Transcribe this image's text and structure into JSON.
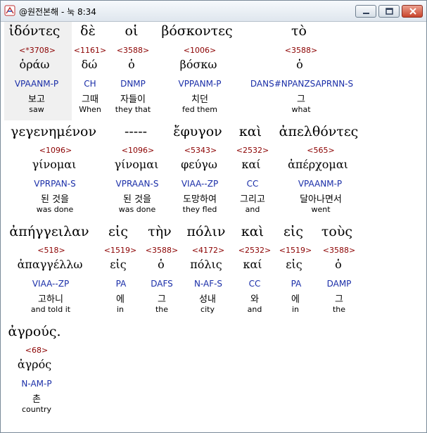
{
  "window": {
    "title": "@원전본해 - 눅 8:34"
  },
  "rows": [
    {
      "words": [
        {
          "greek": "ἰδόντες",
          "strong": "<*3708>",
          "lemma": "ὁράω",
          "parse": "VPAANM-P",
          "korean": "보고",
          "english": "saw"
        },
        {
          "greek": "δὲ",
          "strong": "<1161>",
          "lemma": "δώ",
          "parse": "CH",
          "korean": "그때",
          "english": "When"
        },
        {
          "greek": "οἱ",
          "strong": "<3588>",
          "lemma": "ὁ",
          "parse": "DNMP",
          "korean": "자들이",
          "english": "they that"
        },
        {
          "greek": "βόσκοντες",
          "strong": "<1006>",
          "lemma": "βόσκω",
          "parse": "VPPANM-P",
          "korean": "치던",
          "english": "fed them"
        },
        {
          "greek": "τὸ",
          "strong": "<3588>",
          "lemma": "ὁ",
          "parse": "DANS#NPANZSAPRNN-S",
          "korean": "그",
          "english": "what"
        }
      ]
    },
    {
      "words": [
        {
          "greek": "γεγενημένον",
          "strong": "<1096>",
          "lemma": "γίνομαι",
          "parse": "VPRPAN-S",
          "korean": "된 것을",
          "english": "was done"
        },
        {
          "greek": "-----",
          "strong": "<1096>",
          "lemma": "γίνομαι",
          "parse": "VPRAAN-S",
          "korean": "된 것을",
          "english": "was done"
        },
        {
          "greek": "ἔφυγον",
          "strong": "<5343>",
          "lemma": "φεύγω",
          "parse": "VIAA--ZP",
          "korean": "도망하여",
          "english": "they fled"
        },
        {
          "greek": "καὶ",
          "strong": "<2532>",
          "lemma": "καί",
          "parse": "CC",
          "korean": "그리고",
          "english": "and"
        },
        {
          "greek": "ἀπελθόντες",
          "strong": "<565>",
          "lemma": "ἀπέρχομαι",
          "parse": "VPAANM-P",
          "korean": "달아나면서",
          "english": "went"
        }
      ]
    },
    {
      "words": [
        {
          "greek": "ἀπήγγειλαν",
          "strong": "<518>",
          "lemma": "ἀπαγγέλλω",
          "parse": "VIAA--ZP",
          "korean": "고하니",
          "english": "and told it"
        },
        {
          "greek": "εἰς",
          "strong": "<1519>",
          "lemma": "εἰς",
          "parse": "PA",
          "korean": "에",
          "english": "in"
        },
        {
          "greek": "τὴν",
          "strong": "<3588>",
          "lemma": "ὁ",
          "parse": "DAFS",
          "korean": "그",
          "english": "the"
        },
        {
          "greek": "πόλιν",
          "strong": "<4172>",
          "lemma": "πόλις",
          "parse": "N-AF-S",
          "korean": "성내",
          "english": "city"
        },
        {
          "greek": "καὶ",
          "strong": "<2532>",
          "lemma": "καί",
          "parse": "CC",
          "korean": "와",
          "english": "and"
        },
        {
          "greek": "εἰς",
          "strong": "<1519>",
          "lemma": "εἰς",
          "parse": "PA",
          "korean": "에",
          "english": "in"
        },
        {
          "greek": "τοὺς",
          "strong": "<3588>",
          "lemma": "ὁ",
          "parse": "DAMP",
          "korean": "그",
          "english": "the"
        }
      ]
    },
    {
      "words": [
        {
          "greek": "ἀγρούς.",
          "strong": "<68>",
          "lemma": "ἀγρός",
          "parse": "N-AM-P",
          "korean": "촌",
          "english": "country"
        }
      ]
    }
  ],
  "colors": {
    "strong": "#8b0000",
    "parse": "#1a2ea8",
    "highlight": "#f0f0f0"
  }
}
